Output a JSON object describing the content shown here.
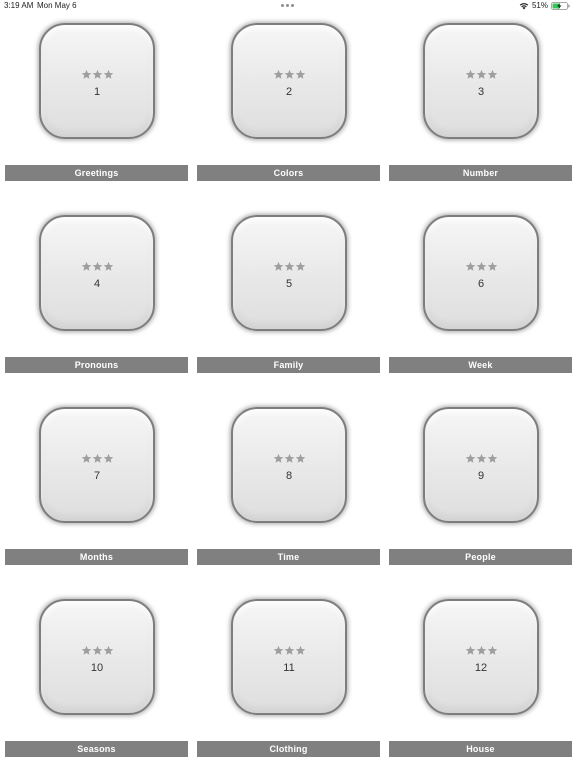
{
  "status": {
    "time": "3:19 AM",
    "date": "Mon May 6",
    "battery": "51%"
  },
  "categories": [
    {
      "number": "1",
      "label": "Greetings"
    },
    {
      "number": "2",
      "label": "Colors"
    },
    {
      "number": "3",
      "label": "Number"
    },
    {
      "number": "4",
      "label": "Pronouns"
    },
    {
      "number": "5",
      "label": "Family"
    },
    {
      "number": "6",
      "label": "Week"
    },
    {
      "number": "7",
      "label": "Months"
    },
    {
      "number": "8",
      "label": "Time"
    },
    {
      "number": "9",
      "label": "People"
    },
    {
      "number": "10",
      "label": "Seasons"
    },
    {
      "number": "11",
      "label": "Clothing"
    },
    {
      "number": "12",
      "label": "House"
    }
  ],
  "star_count": 3,
  "colors": {
    "label_bar": "#808080",
    "star": "#9e9e9e",
    "tile_border": "#7d7d7d"
  }
}
